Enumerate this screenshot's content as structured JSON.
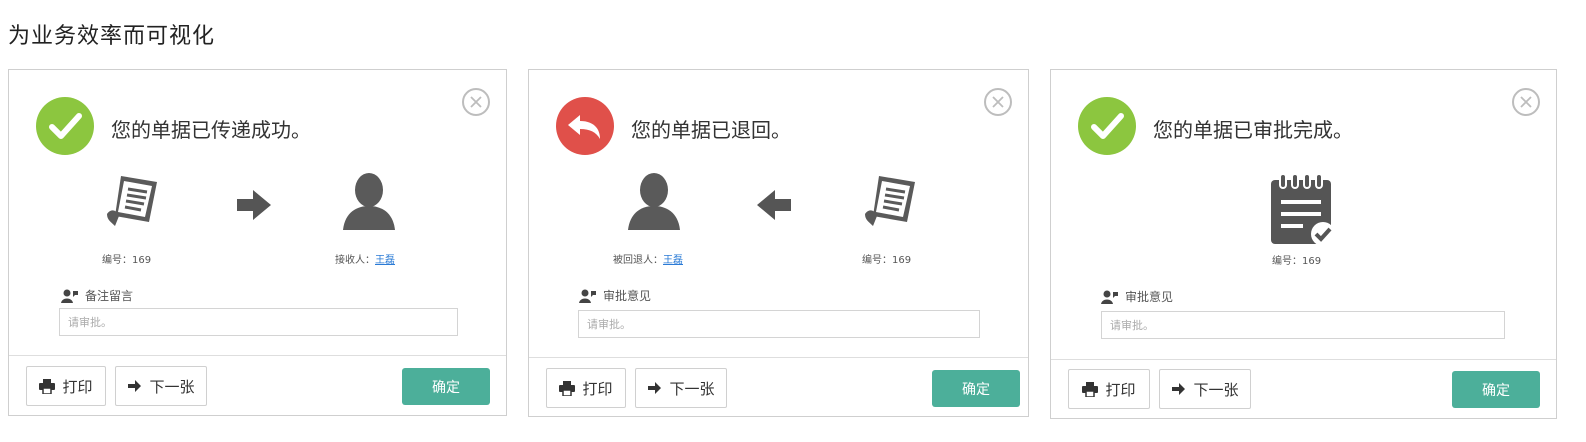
{
  "page": {
    "title": "为业务效率而可视化"
  },
  "colors": {
    "success": "#8cc63f",
    "returned": "#e0504a",
    "confirm": "#4caf9a",
    "link": "#2b7bd6"
  },
  "dialogs": [
    {
      "status": "success",
      "message": "您的单据已传递成功。",
      "doc_caption": "编号：169",
      "user_caption_prefix": "接收人：",
      "user_name": "王磊",
      "remark_label": "备注留言",
      "remark_placeholder": "请审批。",
      "print_label": "打印",
      "next_label": "下一张",
      "confirm_label": "确定"
    },
    {
      "status": "returned",
      "message": "您的单据已退回。",
      "user_caption_prefix": "被回退人：",
      "user_name": "王磊",
      "doc_caption": "编号：169",
      "remark_label": "审批意见",
      "remark_placeholder": "请审批。",
      "print_label": "打印",
      "next_label": "下一张",
      "confirm_label": "确定"
    },
    {
      "status": "success",
      "message": "您的单据已审批完成。",
      "doc_caption": "编号：169",
      "remark_label": "审批意见",
      "remark_placeholder": "请审批。",
      "print_label": "打印",
      "next_label": "下一张",
      "confirm_label": "确定"
    }
  ]
}
